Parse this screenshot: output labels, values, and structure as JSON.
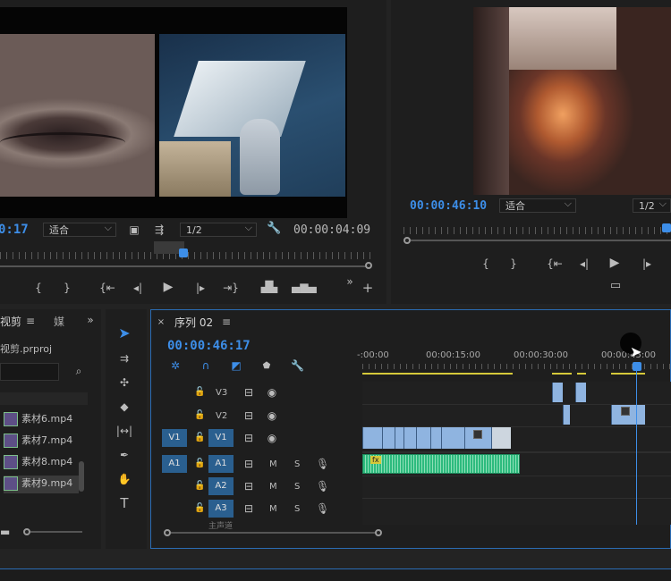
{
  "source_monitor": {
    "timecode_left": "0:17",
    "fit_label": "适合",
    "resolution": "1/2",
    "duration": "00:00:04:09"
  },
  "program_monitor": {
    "timecode": "00:00:46:10",
    "fit_label": "适合",
    "resolution": "1/2"
  },
  "project_panel": {
    "tab_title": "视剪",
    "tab2": "媒",
    "file": "视剪.prproj",
    "items": [
      "素材6.mp4",
      "素材7.mp4",
      "素材8.mp4",
      "素材9.mp4"
    ]
  },
  "timeline": {
    "sequence_tab": "序列 02",
    "timecode": "00:00:46:17",
    "ruler": [
      "-:00:00",
      "00:00:15:00",
      "00:00:30:00",
      "00:00:45:00"
    ],
    "video_tracks": [
      "V3",
      "V2",
      "V1"
    ],
    "audio_tracks": [
      "A1",
      "A2",
      "A3"
    ],
    "source_patch_video": "V1",
    "source_patch_audio": "A1",
    "mute_label": "M",
    "solo_label": "S",
    "master_label": "主声道",
    "fx_badge": "fx"
  },
  "colors": {
    "timecode_blue": "#3d8ee8",
    "video_clip": "#8fb4e0",
    "audio_clip": "#2dbb7e",
    "target_blue": "#2a5f8f",
    "work_area_yellow": "#d6c93a"
  },
  "icons": [
    "play-icon",
    "step-back-icon",
    "step-forward-icon",
    "mark-in-icon",
    "mark-out-icon",
    "go-to-in-icon",
    "go-to-out-icon",
    "insert-icon",
    "overwrite-icon",
    "export-frame-icon",
    "wrench-icon",
    "add-icon",
    "selection-tool-icon",
    "track-select-icon",
    "ripple-edit-icon",
    "razor-icon",
    "slip-icon",
    "pen-icon",
    "hand-icon",
    "type-icon",
    "lock-icon",
    "eye-icon",
    "mic-icon",
    "snap-icon",
    "linked-selection-icon",
    "marker-icon",
    "settings-icon"
  ]
}
